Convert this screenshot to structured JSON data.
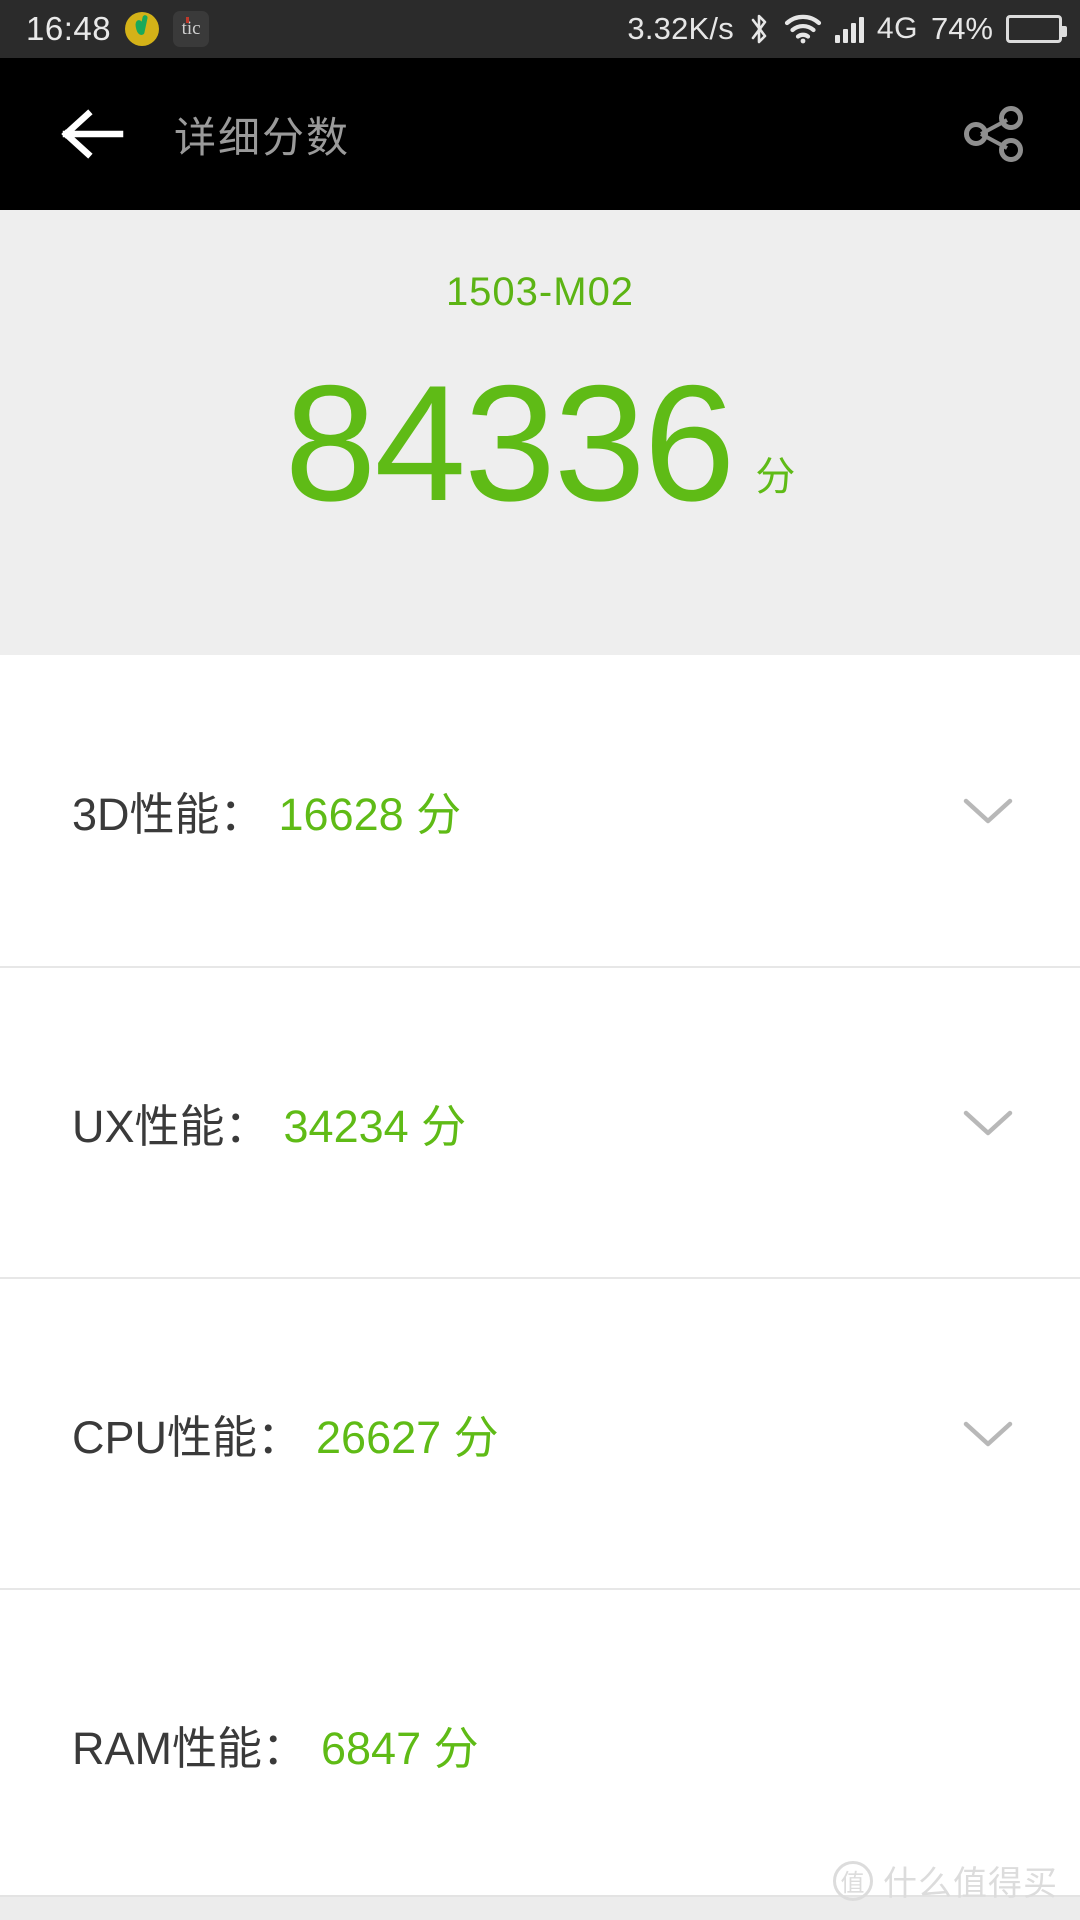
{
  "statusbar": {
    "clock": "16:48",
    "notifications": [
      {
        "name": "qq-music-icon",
        "label": ""
      },
      {
        "name": "tic-icon",
        "label": "tic"
      }
    ],
    "net_speed": "3.32K/s",
    "bluetooth_icon": "bluetooth-icon",
    "wifi_icon": "wifi-icon",
    "signal_icon": "cellular-signal-icon",
    "network_type": "4G",
    "battery_percent": "74%",
    "battery_icon": "battery-icon",
    "battery_fill_ratio": 0.74,
    "bg_color": "#2b2b2b",
    "fg_color": "#e6e6e6"
  },
  "appbar": {
    "back_icon": "arrow-left-icon",
    "title": "详细分数",
    "share_icon": "share-icon",
    "bg_color": "#000000",
    "title_color": "#9a9a9a"
  },
  "score_header": {
    "device_model": "1503-M02",
    "total_score": "84336",
    "unit": "分",
    "bg_color": "#eeeeee",
    "accent_color": "#5fbb16"
  },
  "rows": [
    {
      "label": "3D性能：",
      "value": "16628 分",
      "chevron": "chevron-down-icon",
      "expandable": true
    },
    {
      "label": "UX性能：",
      "value": "34234 分",
      "chevron": "chevron-down-icon",
      "expandable": true
    },
    {
      "label": "CPU性能：",
      "value": "26627 分",
      "chevron": "chevron-down-icon",
      "expandable": true
    },
    {
      "label": "RAM性能：",
      "value": "6847 分",
      "chevron": "",
      "expandable": false
    }
  ],
  "watermark": {
    "badge": "值",
    "text": "什么值得买"
  }
}
